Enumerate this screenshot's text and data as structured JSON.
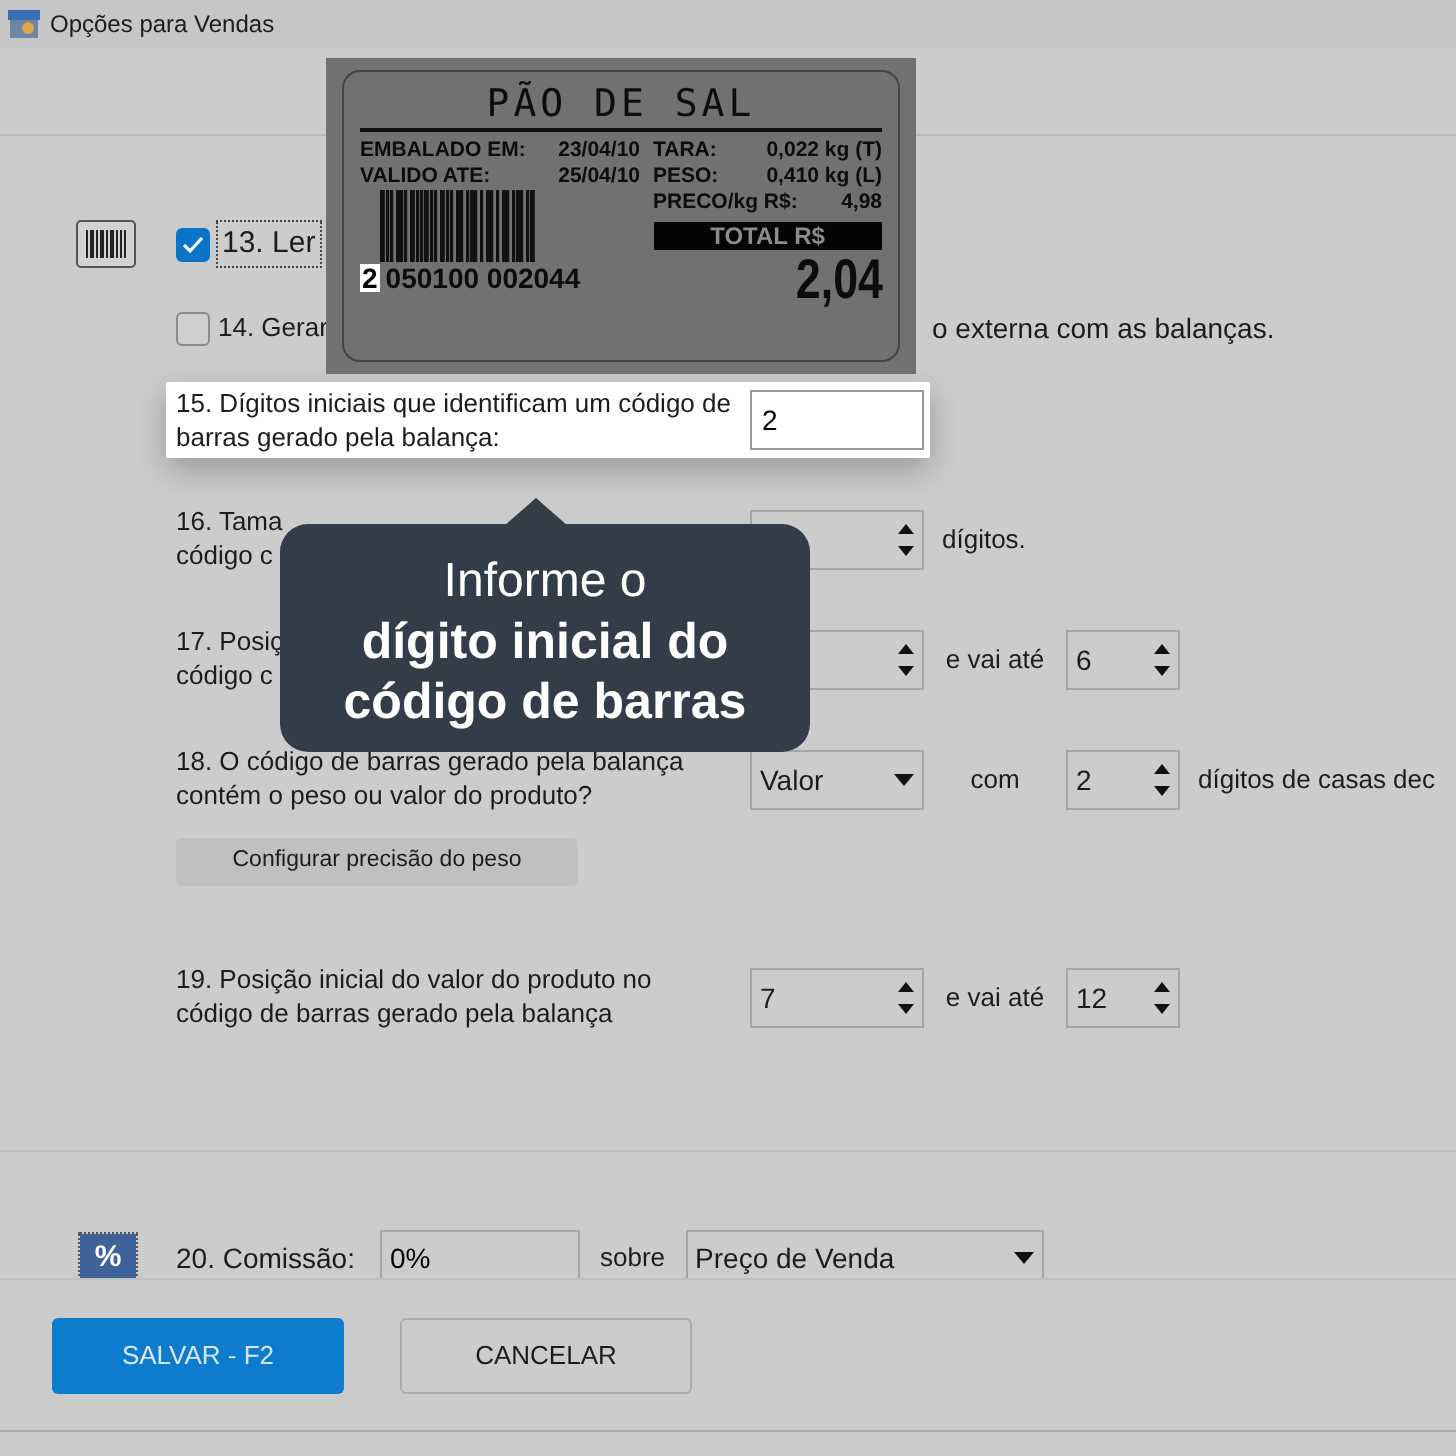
{
  "window": {
    "title": "Opções para Vendas"
  },
  "option_13": {
    "label": "13. Ler",
    "checked": true
  },
  "option_14": {
    "label": "14. Gerar",
    "trailing": "o externa com as balanças.",
    "checked": false
  },
  "option_15": {
    "label": "15. Dígitos iniciais que identificam um código de barras gerado pela balança:",
    "value": "2"
  },
  "rows": [
    {
      "label_lines": [
        "16. Tama",
        "código c"
      ],
      "controls": [
        {
          "kind": "spinner"
        },
        {
          "kind": "text",
          "text": "dígitos."
        }
      ]
    },
    {
      "label_lines": [
        "17. Posiç",
        "código c"
      ],
      "controls": [
        {
          "kind": "spinner"
        },
        {
          "kind": "text",
          "text": "e vai até"
        },
        {
          "kind": "spinner",
          "value": "6"
        }
      ]
    },
    {
      "label_lines": [
        "18. O código de barras gerado pela balança",
        "contém o peso ou valor do produto?"
      ],
      "controls": [
        {
          "kind": "select",
          "value": "Valor"
        },
        {
          "kind": "text",
          "text": "com"
        },
        {
          "kind": "spinner",
          "value": "2"
        },
        {
          "kind": "text",
          "text": "dígitos de casas dec"
        }
      ],
      "button": "Configurar precisão do peso"
    },
    {
      "label_lines": [
        "19. Posição inicial do valor do produto no",
        "código de barras gerado pela balança"
      ],
      "controls": [
        {
          "kind": "spinner",
          "value": "7"
        },
        {
          "kind": "text",
          "text": "e vai até"
        },
        {
          "kind": "spinner",
          "value": "12"
        }
      ]
    }
  ],
  "commission": {
    "icon_text": "%",
    "label": "20. Comissão:",
    "value": "0%",
    "joiner": "sobre",
    "basis": "Preço de Venda"
  },
  "buttons": [
    {
      "label": "SALVAR - F2",
      "kind": "primary"
    },
    {
      "label": "CANCELAR",
      "kind": "secondary"
    }
  ],
  "tooltip": {
    "text": "Informe o **dígito inicial do código de barras**"
  },
  "scale_label": {
    "product": "PÃO DE SAL",
    "left_rows": [
      {
        "label": "EMBALADO EM:",
        "value": "23/04/10"
      },
      {
        "label": "VALIDO ATE:",
        "value": "25/04/10"
      }
    ],
    "right_rows": [
      {
        "label": "TARA:",
        "value": "0,022 kg (T)"
      },
      {
        "label": "PESO:",
        "value": "0,410 kg (L)"
      },
      {
        "label": "PRECO/kg R$:",
        "value": "4,98"
      }
    ],
    "total_label": "TOTAL R$",
    "total": "2,04",
    "barcode_prefix": "2",
    "barcode_rest": "050100 002044"
  }
}
